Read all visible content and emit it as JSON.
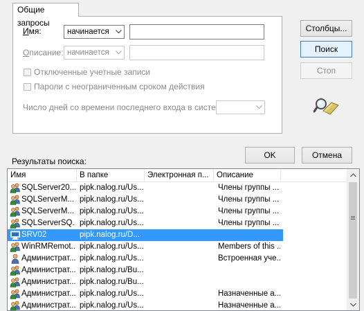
{
  "tab": {
    "label": "Общие запросы"
  },
  "form": {
    "name": {
      "label": "Имя:",
      "mode": "начинается с",
      "value": ""
    },
    "description": {
      "label": "Описание:",
      "mode": "начинается с",
      "value": ""
    },
    "disabled_accounts": {
      "label": "Отключенные учетные записи",
      "checked": false
    },
    "no_expire_pwd": {
      "label": "Пароли с неограниченным сроком действия",
      "checked": false
    },
    "days_since_logon": {
      "label": "Число дней со времени последнего входа в систему:",
      "value": ""
    }
  },
  "buttons": {
    "columns": "Столбцы...",
    "find": "Поиск",
    "stop": "Стоп",
    "ok": "OK",
    "cancel": "Отмена"
  },
  "results": {
    "label": "Результаты поиска:",
    "columns": [
      "Имя",
      "В папке",
      "Электронная п...",
      "Описание"
    ],
    "rows": [
      {
        "icon": "group-icon",
        "name": "SQLServer20...",
        "folder": "pipk.nalog.ru/Us...",
        "email": "",
        "desc": "Члены группы ...",
        "selected": false
      },
      {
        "icon": "group-icon",
        "name": "SQLServerM...",
        "folder": "pipk.nalog.ru/Us...",
        "email": "",
        "desc": "Члены группы ...",
        "selected": false
      },
      {
        "icon": "group-icon",
        "name": "SQLServerM...",
        "folder": "pipk.nalog.ru/Us...",
        "email": "",
        "desc": "Члены группы ...",
        "selected": false
      },
      {
        "icon": "group-icon",
        "name": "SQLServerSQ...",
        "folder": "pipk.nalog.ru/Us...",
        "email": "",
        "desc": "Члены группы ...",
        "selected": false
      },
      {
        "icon": "computer-icon",
        "name": "SRV02",
        "folder": "pipk.nalog.ru/D...",
        "email": "",
        "desc": "",
        "selected": true
      },
      {
        "icon": "group-icon",
        "name": "WinRMRemot...",
        "folder": "pipk.nalog.ru/Us...",
        "email": "",
        "desc": "Members of this ...",
        "selected": false
      },
      {
        "icon": "user-icon",
        "name": "Администрат...",
        "folder": "pipk.nalog.ru/Us...",
        "email": "",
        "desc": "Встроенная уче...",
        "selected": false
      },
      {
        "icon": "group-icon",
        "name": "Администрат...",
        "folder": "pipk.nalog.ru/Bu...",
        "email": "",
        "desc": "",
        "selected": false
      },
      {
        "icon": "group-icon",
        "name": "Администрат...",
        "folder": "pipk.nalog.ru/Bu...",
        "email": "",
        "desc": "",
        "selected": false
      },
      {
        "icon": "group-icon",
        "name": "Администрат...",
        "folder": "pipk.nalog.ru/Us...",
        "email": "",
        "desc": "Назначенные а...",
        "selected": false
      },
      {
        "icon": "group-icon",
        "name": "Администрат...",
        "folder": "pipk.nalog.ru/Us...",
        "email": "",
        "desc": "Назначенные а...",
        "selected": false
      }
    ]
  },
  "colors": {
    "selection": "#3399ff",
    "window_bg": "#f0f0f0"
  }
}
